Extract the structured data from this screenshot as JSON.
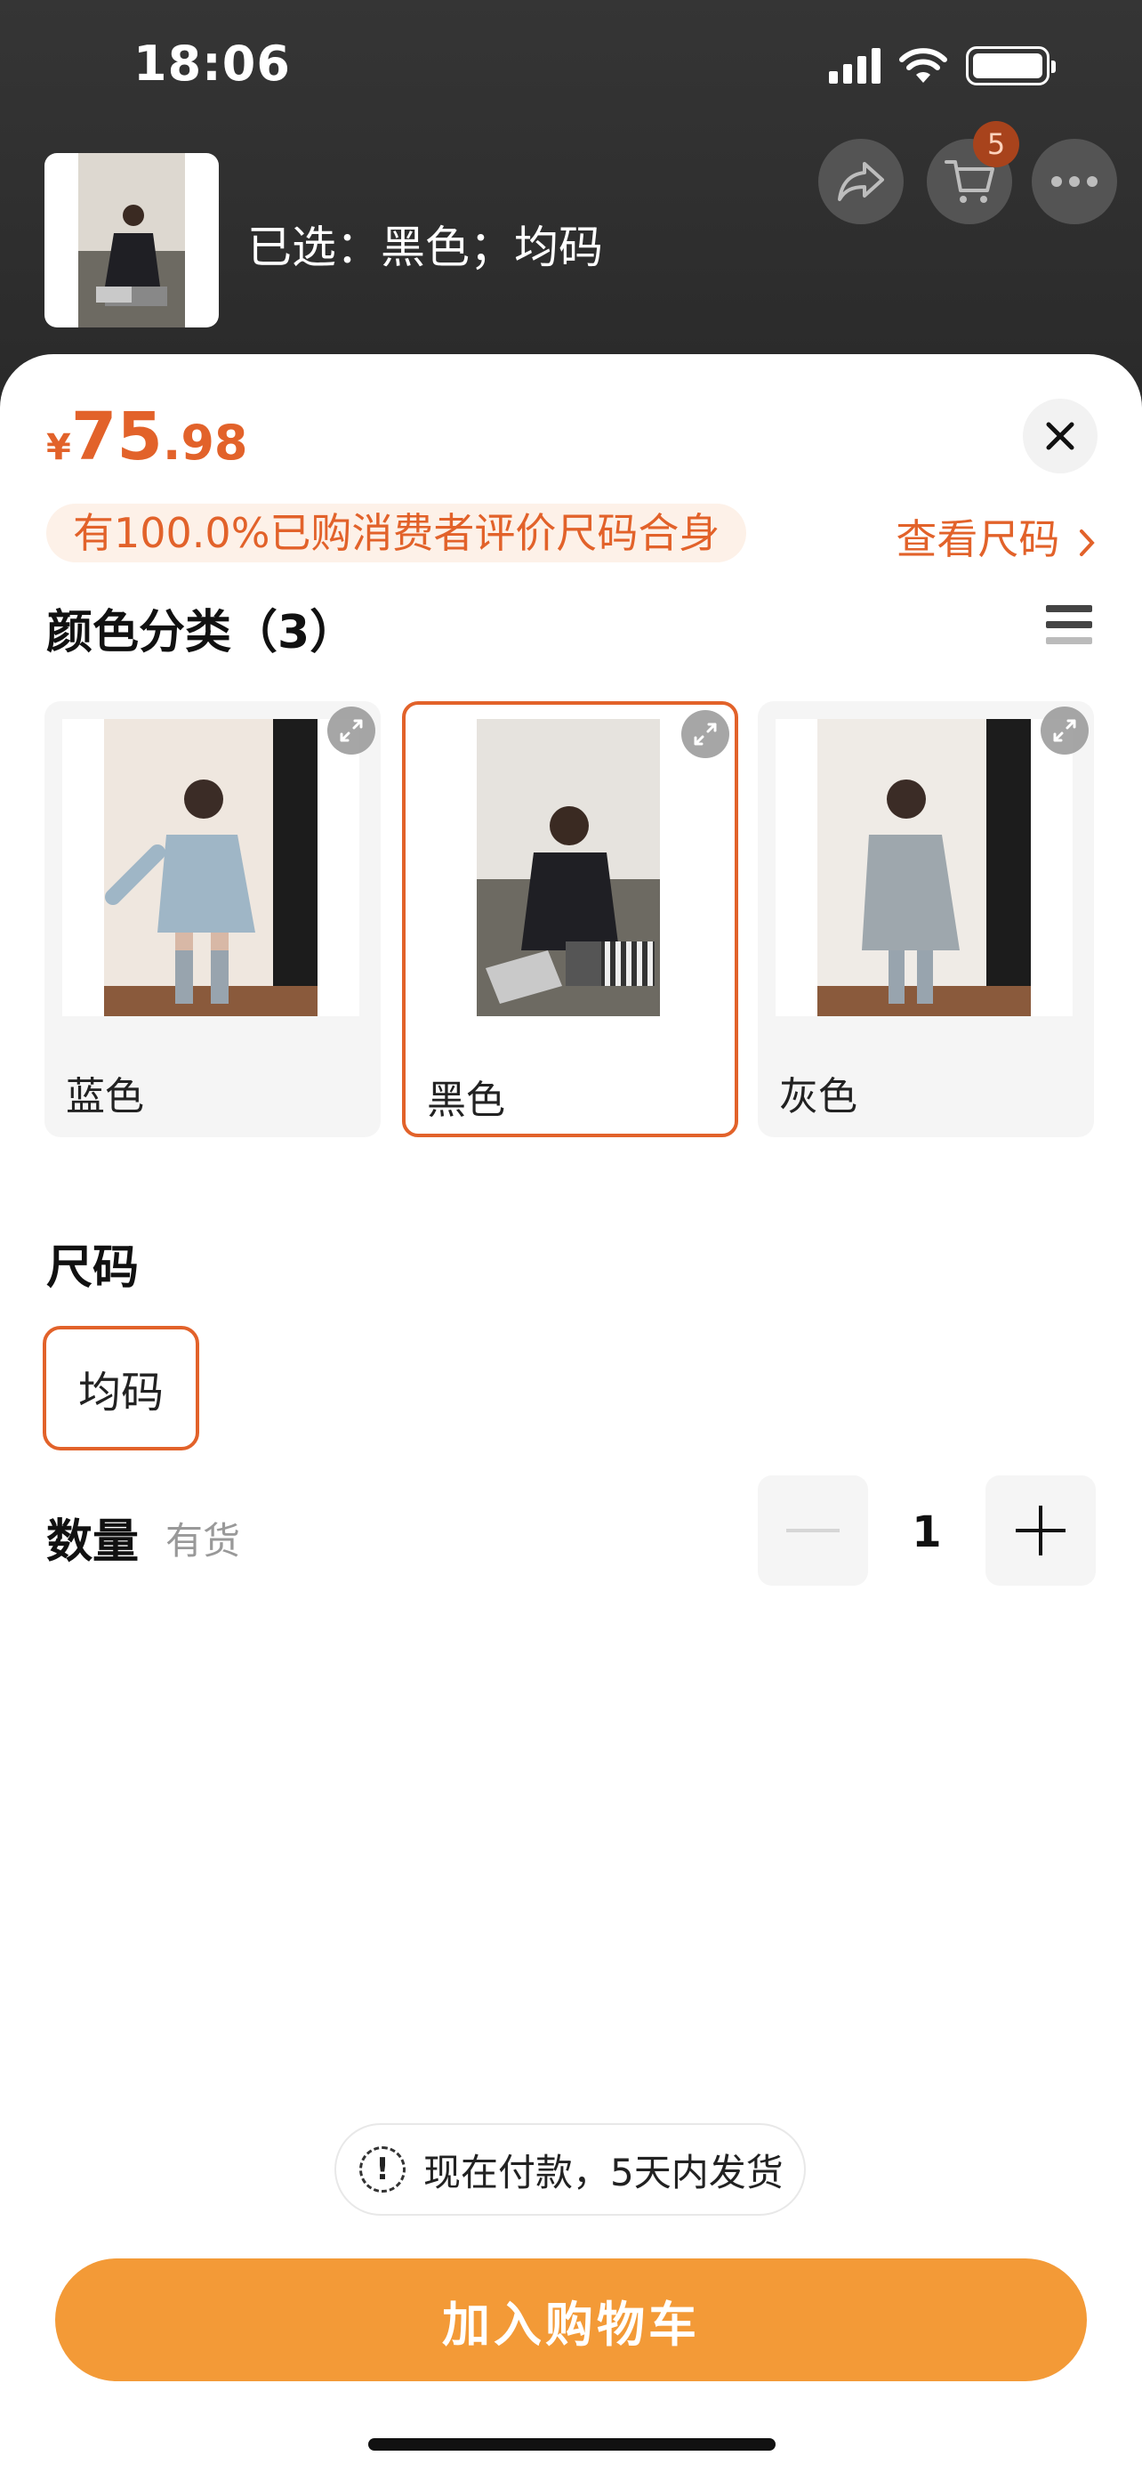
{
  "status_bar": {
    "time": "18:06"
  },
  "header": {
    "cart_count": "5",
    "selected_text": "已选：黑色；均码",
    "icons": {
      "share": "share-icon",
      "cart": "cart-icon",
      "more": "more-dots-icon"
    }
  },
  "sheet": {
    "price": {
      "currency": "¥",
      "integer": "75",
      "decimal": ".98"
    },
    "fit_notice": "有100.0%已购消费者评价尺码合身",
    "size_chart_link": "查看尺码",
    "color_section_title": "颜色分类（3）",
    "colors": [
      {
        "label": "蓝色",
        "selected": false
      },
      {
        "label": "黑色",
        "selected": true
      },
      {
        "label": "灰色",
        "selected": false
      }
    ],
    "size_section_title": "尺码",
    "sizes": [
      {
        "label": "均码",
        "selected": true
      }
    ],
    "quantity_label": "数量",
    "stock_label": "有货",
    "quantity_value": "1",
    "shipping_notice": "现在付款，5天内发货",
    "add_to_cart_label": "加入购物车"
  },
  "colors": {
    "accent": "#e2622a",
    "button": "#f39a37"
  }
}
